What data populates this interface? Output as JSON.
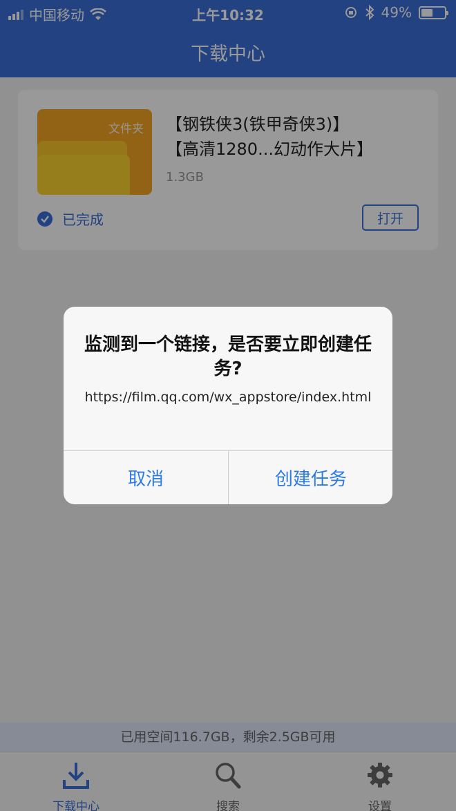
{
  "status_bar": {
    "carrier": "中国移动",
    "time": "上午10:32",
    "battery_percent": "49%",
    "battery_level": 0.49
  },
  "nav": {
    "title": "下载中心"
  },
  "download_item": {
    "thumbnail_label": "文件夹",
    "title_line1": "【钢铁侠3(铁甲奇侠3)】",
    "title_line2": "【高清1280...幻动作大片】",
    "size": "1.3GB",
    "status": "已完成",
    "open_label": "打开"
  },
  "storage": {
    "text": "已用空间116.7GB，剩余2.5GB可用"
  },
  "tabs": [
    {
      "label": "下载中心",
      "icon": "download-icon",
      "active": true
    },
    {
      "label": "搜索",
      "icon": "search-icon",
      "active": false
    },
    {
      "label": "设置",
      "icon": "gear-icon",
      "active": false
    }
  ],
  "alert": {
    "title": "监测到一个链接，是否要立即创建任务?",
    "message": "https://film.qq.com/wx_appstore/index.html",
    "cancel_label": "取消",
    "confirm_label": "创建任务"
  },
  "colors": {
    "accent": "#3a6fd8",
    "alert_button": "#2d7be3",
    "folder": "#f8c52a"
  }
}
